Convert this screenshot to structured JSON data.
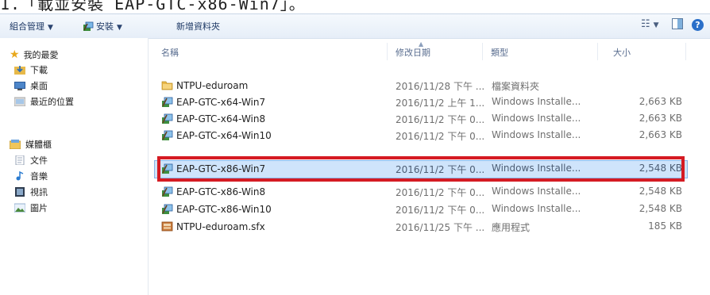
{
  "caption": "1.「載並安裝 EAP-GTC-x86-Win7」。",
  "toolbar": {
    "organize": "組合管理",
    "install": "安裝",
    "new_folder": "新增資料夾",
    "help": "?"
  },
  "nav": {
    "favorites": "我的最愛",
    "downloads": "下載",
    "desktop": "桌面",
    "recent": "最近的位置",
    "libraries": "媒體櫃",
    "documents": "文件",
    "music": "音樂",
    "videos": "視訊",
    "pictures": "圖片"
  },
  "columns": {
    "name": "名稱",
    "date": "修改日期",
    "type": "類型",
    "size": "大小"
  },
  "files": [
    {
      "name": "NTPU-eduroam",
      "date": "2016/11/28 下午 ...",
      "type": "檔案資料夾",
      "size": "",
      "icon": "folder-icon"
    },
    {
      "name": "EAP-GTC-x64-Win7",
      "date": "2016/11/2 上午 1...",
      "type": "Windows Installe...",
      "size": "2,663 KB",
      "icon": "installer-icon"
    },
    {
      "name": "EAP-GTC-x64-Win8",
      "date": "2016/11/2 下午 0...",
      "type": "Windows Installe...",
      "size": "2,663 KB",
      "icon": "installer-icon"
    },
    {
      "name": "EAP-GTC-x64-Win10",
      "date": "2016/11/2 下午 0...",
      "type": "Windows Installe...",
      "size": "2,663 KB",
      "icon": "installer-icon"
    },
    {
      "name": "EAP-GTC-x86-Win7",
      "date": "2016/11/2 下午 0...",
      "type": "Windows Installe...",
      "size": "2,548 KB",
      "icon": "installer-icon"
    },
    {
      "name": "EAP-GTC-x86-Win8",
      "date": "2016/11/2 下午 0...",
      "type": "Windows Installe...",
      "size": "2,548 KB",
      "icon": "installer-icon"
    },
    {
      "name": "EAP-GTC-x86-Win10",
      "date": "2016/11/2 下午 0...",
      "type": "Windows Installe...",
      "size": "2,548 KB",
      "icon": "installer-icon"
    },
    {
      "name": "NTPU-eduroam.sfx",
      "date": "2016/11/25 下午 ...",
      "type": "應用程式",
      "size": "185 KB",
      "icon": "sfx-app-icon"
    }
  ],
  "colors": {
    "highlight": "#d51b23",
    "selected_row": "#cfe4fb"
  }
}
